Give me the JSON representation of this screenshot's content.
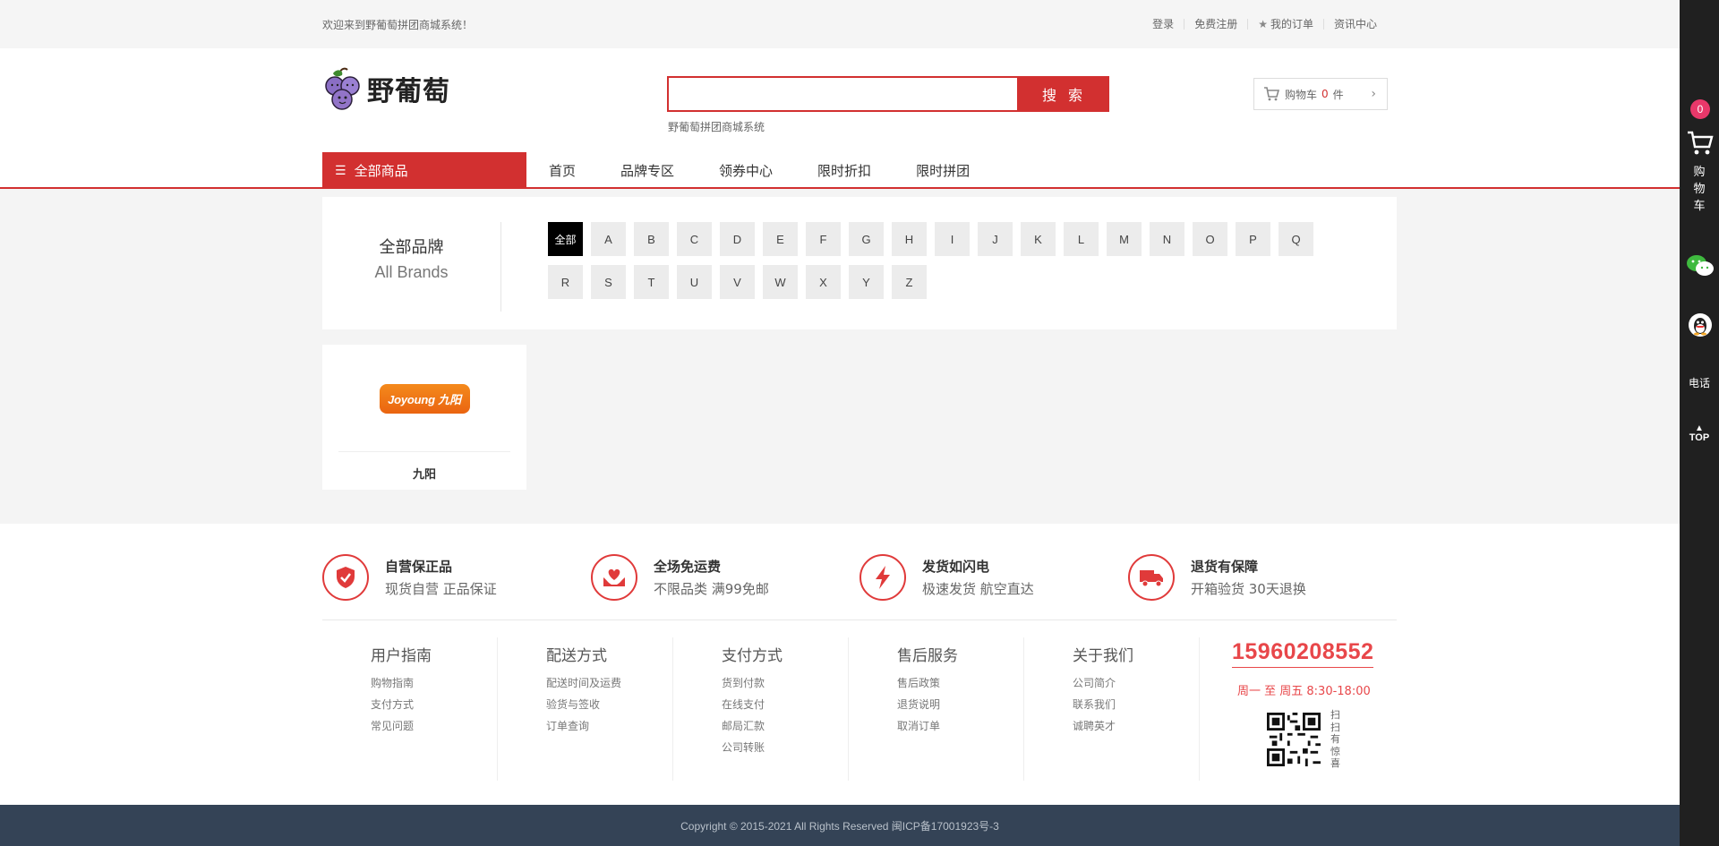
{
  "topbar": {
    "welcome": "欢迎来到野葡萄拼团商城系统！",
    "links": [
      "登录",
      "免费注册",
      "我的订单",
      "资讯中心"
    ]
  },
  "header": {
    "logo_text": "野葡萄",
    "search_placeholder": "",
    "search_button": "搜 索",
    "hot_text": "野葡萄拼团商城系统",
    "cart_label": "购物车",
    "cart_count": "0",
    "cart_unit": "件"
  },
  "nav": {
    "all_category": "全部商品",
    "items": [
      "首页",
      "品牌专区",
      "领券中心",
      "限时折扣",
      "限时拼团"
    ]
  },
  "brands": {
    "title_cn": "全部品牌",
    "title_en": "All Brands",
    "letters": [
      "全部",
      "A",
      "B",
      "C",
      "D",
      "E",
      "F",
      "G",
      "H",
      "I",
      "J",
      "K",
      "L",
      "M",
      "N",
      "O",
      "P",
      "Q",
      "R",
      "S",
      "T",
      "U",
      "V",
      "W",
      "X",
      "Y",
      "Z"
    ],
    "active_letter": "全部",
    "list": [
      {
        "name": "九阳",
        "logo_text": "Joyoung 九阳"
      }
    ]
  },
  "features": [
    {
      "title": "自营保正品",
      "desc": "现货自营 正品保证",
      "icon": "shield-icon"
    },
    {
      "title": "全场免运费",
      "desc": "不限品类 满99免邮",
      "icon": "heart-hands-icon"
    },
    {
      "title": "发货如闪电",
      "desc": "极速发货 航空直达",
      "icon": "lightning-icon"
    },
    {
      "title": "退货有保障",
      "desc": "开箱验货 30天退换",
      "icon": "truck-icon"
    }
  ],
  "footer_cols": [
    {
      "title": "用户指南",
      "links": [
        "购物指南",
        "支付方式",
        "常见问题"
      ]
    },
    {
      "title": "配送方式",
      "links": [
        "配送时间及运费",
        "验货与签收",
        "订单查询"
      ]
    },
    {
      "title": "支付方式",
      "links": [
        "货到付款",
        "在线支付",
        "邮局汇款",
        "公司转账"
      ]
    },
    {
      "title": "售后服务",
      "links": [
        "售后政策",
        "退货说明",
        "取消订单"
      ]
    },
    {
      "title": "关于我们",
      "links": [
        "公司简介",
        "联系我们",
        "诚聘英才"
      ]
    }
  ],
  "contact": {
    "phone": "15960208552",
    "hours": "周一 至 周五   8:30-18:00",
    "scan_text": "扫扫有惊喜"
  },
  "copyright": "Copyright © 2015-2021 All Rights Reserved 闽ICP备17001923号-3",
  "sidebar": {
    "cart_count": "0",
    "cart_label": "购物车",
    "tel_label": "电话",
    "top_label": "TOP"
  },
  "colors": {
    "accent": "#d23030",
    "footer_dark": "#344356",
    "sidebar": "#202020"
  }
}
